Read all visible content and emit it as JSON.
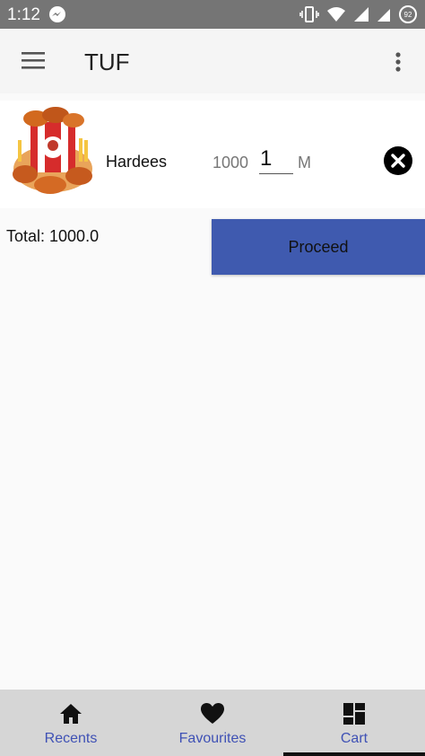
{
  "status_bar": {
    "time": "1:12",
    "battery": "92"
  },
  "app_bar": {
    "title": "TUF"
  },
  "cart": {
    "items": [
      {
        "name": "Hardees",
        "price": "1000",
        "quantity": "1",
        "unit": "M"
      }
    ],
    "total_text": "Total: 1000.0",
    "proceed_label": "Proceed"
  },
  "bottom_nav": {
    "items": [
      {
        "label": "Recents",
        "icon": "home-icon"
      },
      {
        "label": "Favourites",
        "icon": "heart-icon"
      },
      {
        "label": "Cart",
        "icon": "dashboard-icon"
      }
    ],
    "active": "Cart"
  },
  "colors": {
    "accent": "#3f5aaf",
    "nav_label": "#3f51b5",
    "status_bar": "#757575"
  }
}
